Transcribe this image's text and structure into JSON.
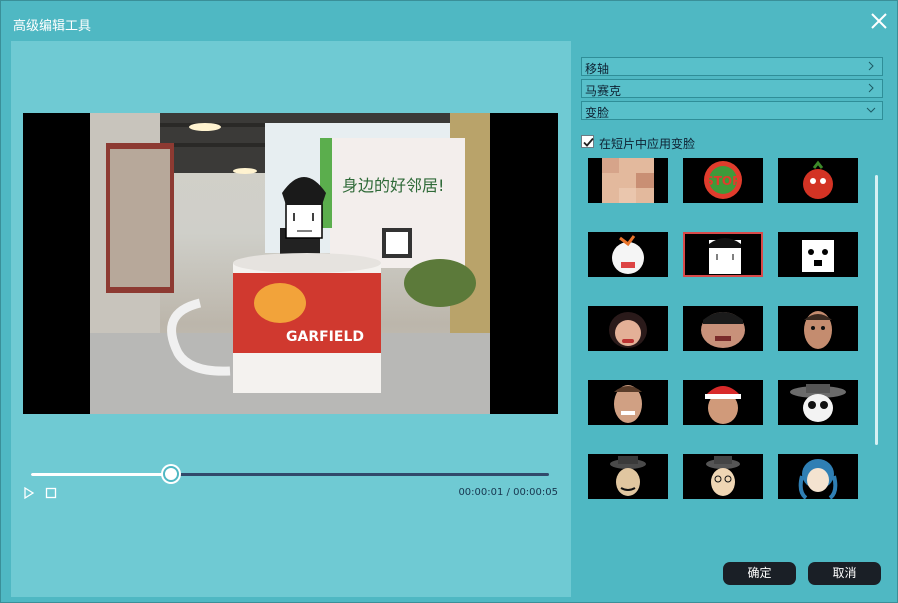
{
  "window": {
    "title": "高级编辑工具"
  },
  "player": {
    "progress": 0.27,
    "time": "00:00:01 / 00:00:05",
    "sign_text": "身边的好邻居!",
    "mug_text": "GARFIELD"
  },
  "panel": {
    "sections": [
      {
        "label": "移轴",
        "state": "collapsed"
      },
      {
        "label": "马赛克",
        "state": "collapsed"
      },
      {
        "label": "变脸",
        "state": "expanded"
      }
    ],
    "apply_label": "在短片中应用变脸",
    "apply_checked": true,
    "selected_face": 4,
    "faces": [
      {
        "name": "mosaic-face-icon"
      },
      {
        "name": "stop-sign-face-icon"
      },
      {
        "name": "tomato-face-icon"
      },
      {
        "name": "angry-cartoon-face-icon"
      },
      {
        "name": "blank-meme-face-icon"
      },
      {
        "name": "surprised-meme-face-icon"
      },
      {
        "name": "woman-face-icon"
      },
      {
        "name": "chubby-face-icon"
      },
      {
        "name": "man-face-icon"
      },
      {
        "name": "smiling-man-face-icon"
      },
      {
        "name": "santa-hat-face-icon"
      },
      {
        "name": "hat-glasses-face-icon"
      },
      {
        "name": "cowboy-face-icon"
      },
      {
        "name": "hat-man-face-icon"
      },
      {
        "name": "blue-hair-girl-face-icon"
      }
    ]
  },
  "buttons": {
    "ok": "确定",
    "cancel": "取消"
  }
}
